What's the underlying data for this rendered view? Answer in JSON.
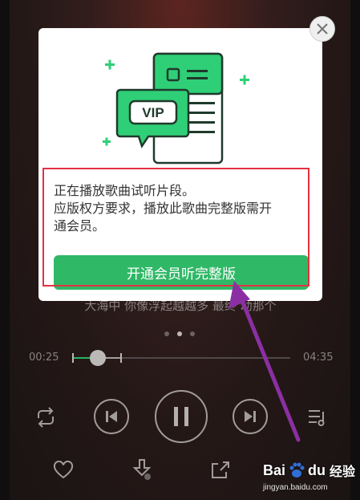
{
  "player": {
    "lyric": "大海中 你像浮起越越多 最终 动那个",
    "time_elapsed": "00:25",
    "time_total": "04:35",
    "progress_fraction": 0.117,
    "buffered_fraction": 0.22,
    "pager": {
      "count": 3,
      "active": 1
    }
  },
  "dialog": {
    "badge": "VIP",
    "message_line1": "正在播放歌曲试听片段。",
    "message_line2": "应版权方要求，播放此歌曲完整版需开",
    "message_line3": "通会员。",
    "button_label": "开通会员听完整版"
  },
  "watermark": {
    "brand": "Bai",
    "brand_suffix": "du",
    "cn": "经验",
    "url": "jingyan.baidu.com"
  },
  "colors": {
    "accent_green": "#2fb866",
    "highlight_red": "#e53141",
    "arrow_purple": "#8b2fa3"
  }
}
